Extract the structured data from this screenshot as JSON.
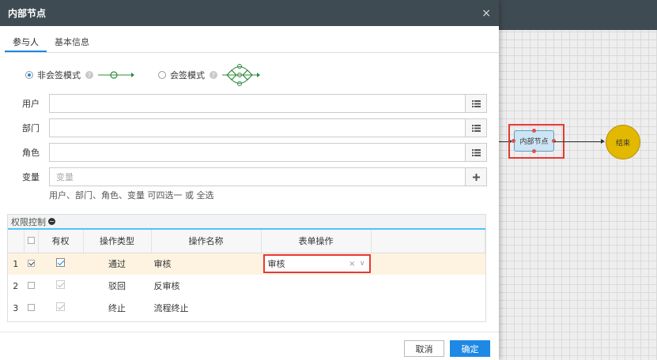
{
  "dialog": {
    "title": "内部节点",
    "close_symbol": "×"
  },
  "tabs": [
    {
      "label": "参与人",
      "active": true
    },
    {
      "label": "基本信息",
      "active": false
    }
  ],
  "modes": {
    "single_label": "非会签模式",
    "multi_label": "会签模式",
    "selected": "single"
  },
  "fields": {
    "user_label": "用户",
    "dept_label": "部门",
    "role_label": "角色",
    "var_label": "变量",
    "var_placeholder": "变量",
    "hint": "用户、部门、角色、变量 可四选一 或 全选"
  },
  "permission": {
    "title": "权限控制",
    "headers": [
      "有权",
      "操作类型",
      "操作名称",
      "表单操作"
    ],
    "rows": [
      {
        "num": "1",
        "selected": true,
        "granted": true,
        "type": "通过",
        "name": "审核",
        "form_op": "审核"
      },
      {
        "num": "2",
        "selected": false,
        "granted": true,
        "type": "驳回",
        "name": "反审核",
        "form_op": ""
      },
      {
        "num": "3",
        "selected": false,
        "granted": true,
        "type": "终止",
        "name": "流程终止",
        "form_op": ""
      }
    ]
  },
  "footer": {
    "cancel_label": "取消",
    "ok_label": "确定"
  },
  "canvas": {
    "node_label": "内部节点",
    "end_label": "结束"
  },
  "colors": {
    "header_bg": "#3f4b52",
    "accent": "#1e88e5",
    "highlight": "#e53935",
    "end_node": "#e3b800"
  }
}
